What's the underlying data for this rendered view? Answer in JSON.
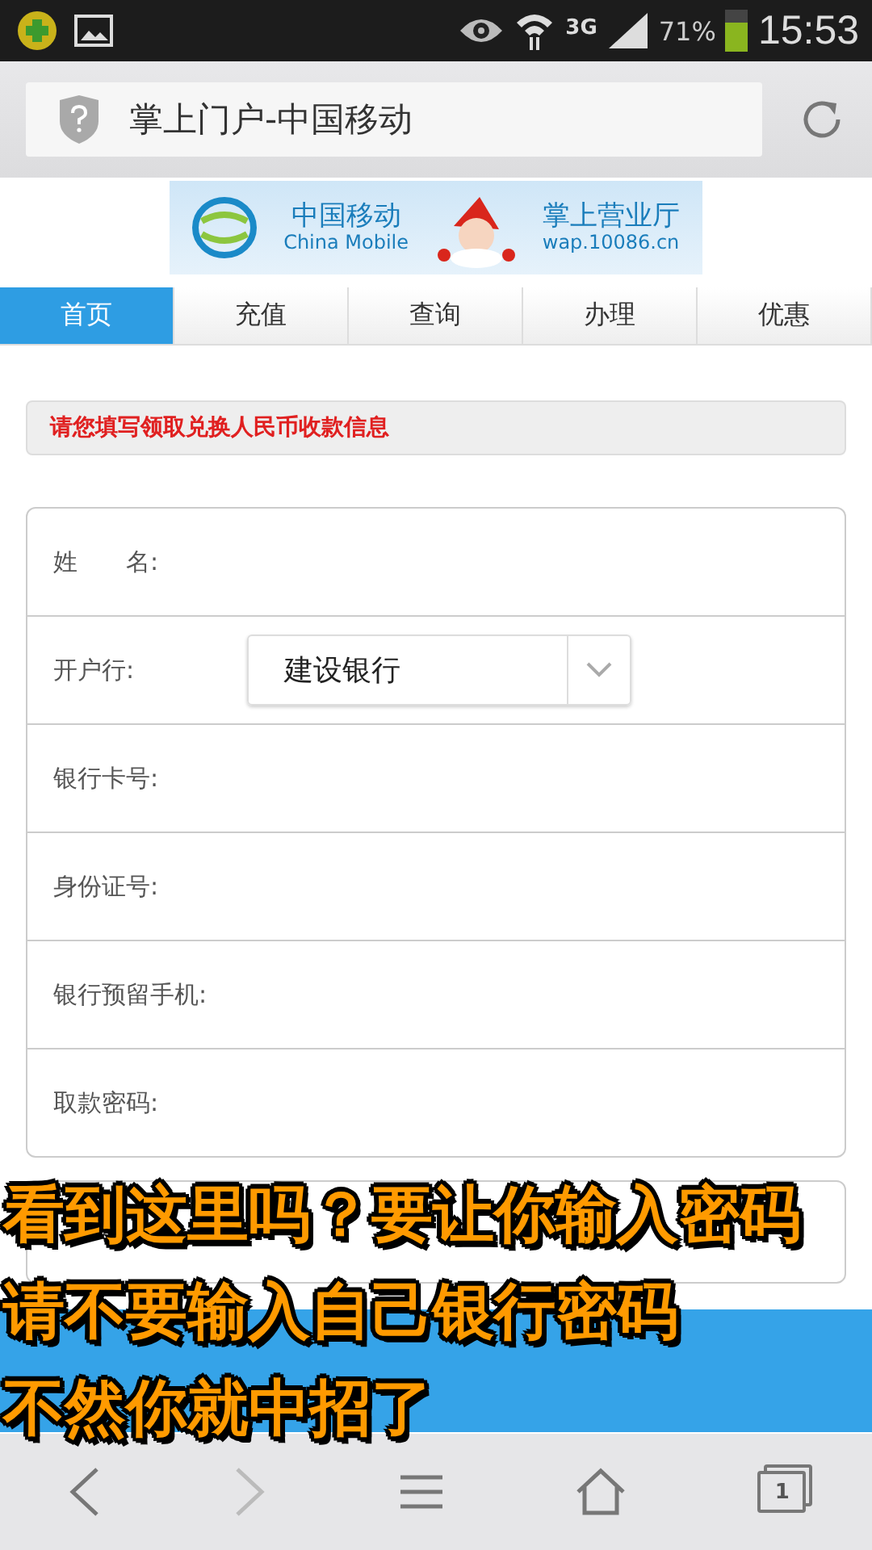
{
  "status_bar": {
    "network": "3G",
    "battery": "71%",
    "time": "15:53"
  },
  "address_bar": {
    "title": "掌上门户-中国移动"
  },
  "banner": {
    "brand_cn": "中国移动",
    "brand_en": "China Mobile",
    "service": "掌上营业厅",
    "url": "wap.10086.cn"
  },
  "tabs": [
    {
      "label": "首页",
      "selected": true
    },
    {
      "label": "充值",
      "selected": false
    },
    {
      "label": "查询",
      "selected": false
    },
    {
      "label": "办理",
      "selected": false
    },
    {
      "label": "优惠",
      "selected": false
    }
  ],
  "notice": "请您填写领取兑换人民币收款信息",
  "form_rows": [
    {
      "label": "姓　　名:",
      "kind": "text"
    },
    {
      "label": "开户行:",
      "kind": "select",
      "value": "建设银行"
    },
    {
      "label": "银行卡号:",
      "kind": "text"
    },
    {
      "label": "身份证号:",
      "kind": "text"
    },
    {
      "label": "银行预留手机:",
      "kind": "text"
    },
    {
      "label": "取款密码:",
      "kind": "text"
    }
  ],
  "captions": [
    "看到这里吗？要让你输入密码",
    "请不要输入自己银行密码",
    "不然你就中招了"
  ],
  "tab_count": "1"
}
